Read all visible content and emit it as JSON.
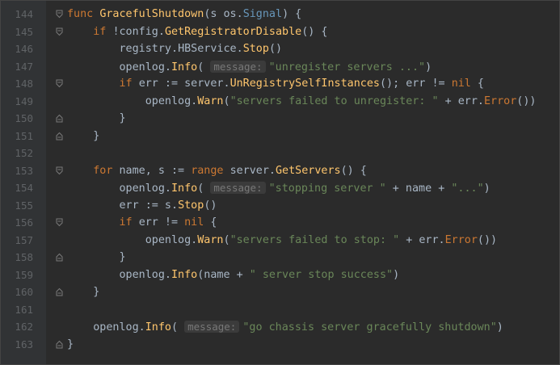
{
  "editor": {
    "line_numbers": [
      "144",
      "145",
      "146",
      "147",
      "148",
      "149",
      "150",
      "151",
      "152",
      "153",
      "154",
      "155",
      "156",
      "157",
      "158",
      "159",
      "160",
      "161",
      "162",
      "163"
    ],
    "lines": [
      [
        {
          "t": "func ",
          "c": "kw"
        },
        {
          "t": "GracefulShutdown",
          "c": "fn"
        },
        {
          "t": "(s ",
          "c": "param"
        },
        {
          "t": "os.",
          "c": ""
        },
        {
          "t": "Signal",
          "c": "type"
        },
        {
          "t": ") {",
          "c": ""
        }
      ],
      [
        {
          "t": "    ",
          "c": ""
        },
        {
          "t": "if ",
          "c": "kw"
        },
        {
          "t": "!config.",
          "c": ""
        },
        {
          "t": "GetRegistratorDisable",
          "c": "fn"
        },
        {
          "t": "() {",
          "c": ""
        }
      ],
      [
        {
          "t": "        registry.",
          "c": ""
        },
        {
          "t": "HBService",
          "c": ""
        },
        {
          "t": ".",
          "c": ""
        },
        {
          "t": "Stop",
          "c": "fn"
        },
        {
          "t": "()",
          "c": ""
        }
      ],
      [
        {
          "t": "        openlog.",
          "c": ""
        },
        {
          "t": "Info",
          "c": "fn"
        },
        {
          "t": "( ",
          "c": ""
        },
        {
          "t": "message:",
          "c": "hint"
        },
        {
          "t": "\"unregister servers ...\"",
          "c": "str"
        },
        {
          "t": ")",
          "c": ""
        }
      ],
      [
        {
          "t": "        ",
          "c": ""
        },
        {
          "t": "if ",
          "c": "kw"
        },
        {
          "t": "err := server.",
          "c": ""
        },
        {
          "t": "UnRegistrySelfInstances",
          "c": "fn"
        },
        {
          "t": "(); err != ",
          "c": ""
        },
        {
          "t": "nil",
          "c": "kw"
        },
        {
          "t": " {",
          "c": ""
        }
      ],
      [
        {
          "t": "            openlog.",
          "c": ""
        },
        {
          "t": "Warn",
          "c": "fn"
        },
        {
          "t": "(",
          "c": ""
        },
        {
          "t": "\"servers failed to unregister: \"",
          "c": "str"
        },
        {
          "t": " + err.",
          "c": ""
        },
        {
          "t": "Error",
          "c": "meth"
        },
        {
          "t": "())",
          "c": ""
        }
      ],
      [
        {
          "t": "        }",
          "c": ""
        }
      ],
      [
        {
          "t": "    }",
          "c": ""
        }
      ],
      [
        {
          "t": "",
          "c": ""
        }
      ],
      [
        {
          "t": "    ",
          "c": ""
        },
        {
          "t": "for ",
          "c": "kw"
        },
        {
          "t": "name, s := ",
          "c": ""
        },
        {
          "t": "range ",
          "c": "kw"
        },
        {
          "t": "server.",
          "c": ""
        },
        {
          "t": "GetServers",
          "c": "fn"
        },
        {
          "t": "() {",
          "c": ""
        }
      ],
      [
        {
          "t": "        openlog.",
          "c": ""
        },
        {
          "t": "Info",
          "c": "fn"
        },
        {
          "t": "( ",
          "c": ""
        },
        {
          "t": "message:",
          "c": "hint"
        },
        {
          "t": "\"stopping server \"",
          "c": "str"
        },
        {
          "t": " + name + ",
          "c": ""
        },
        {
          "t": "\"...\"",
          "c": "str"
        },
        {
          "t": ")",
          "c": ""
        }
      ],
      [
        {
          "t": "        err := s.",
          "c": ""
        },
        {
          "t": "Stop",
          "c": "fn"
        },
        {
          "t": "()",
          "c": ""
        }
      ],
      [
        {
          "t": "        ",
          "c": ""
        },
        {
          "t": "if ",
          "c": "kw"
        },
        {
          "t": "err != ",
          "c": ""
        },
        {
          "t": "nil",
          "c": "kw"
        },
        {
          "t": " {",
          "c": ""
        }
      ],
      [
        {
          "t": "            openlog.",
          "c": ""
        },
        {
          "t": "Warn",
          "c": "fn"
        },
        {
          "t": "(",
          "c": ""
        },
        {
          "t": "\"servers failed to stop: \"",
          "c": "str"
        },
        {
          "t": " + err.",
          "c": ""
        },
        {
          "t": "Error",
          "c": "meth"
        },
        {
          "t": "())",
          "c": ""
        }
      ],
      [
        {
          "t": "        }",
          "c": ""
        }
      ],
      [
        {
          "t": "        openlog.",
          "c": ""
        },
        {
          "t": "Info",
          "c": "fn"
        },
        {
          "t": "(name + ",
          "c": ""
        },
        {
          "t": "\" server stop success\"",
          "c": "str"
        },
        {
          "t": ")",
          "c": ""
        }
      ],
      [
        {
          "t": "    }",
          "c": ""
        }
      ],
      [
        {
          "t": "",
          "c": ""
        }
      ],
      [
        {
          "t": "    openlog.",
          "c": ""
        },
        {
          "t": "Info",
          "c": "fn"
        },
        {
          "t": "( ",
          "c": ""
        },
        {
          "t": "message:",
          "c": "hint"
        },
        {
          "t": "\"go chassis server gracefully shutdown\"",
          "c": "str"
        },
        {
          "t": ")",
          "c": ""
        }
      ],
      [
        {
          "t": "}",
          "c": ""
        }
      ]
    ],
    "fold_markers": [
      "open",
      "open",
      "",
      "",
      "open",
      "",
      "close",
      "close",
      "",
      "open",
      "",
      "",
      "open",
      "",
      "close",
      "",
      "close",
      "",
      "",
      "close"
    ],
    "colors": {
      "background": "#2b2b2b",
      "keyword": "#cc7832",
      "function": "#ffc66d",
      "string": "#6a8759",
      "type": "#6897bb",
      "text": "#a9b7c6",
      "line_number": "#606366"
    }
  }
}
